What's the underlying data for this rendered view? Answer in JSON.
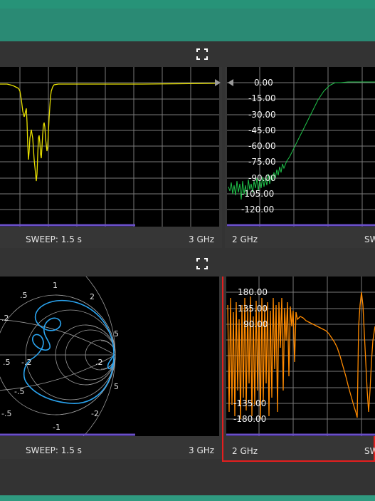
{
  "panels": {
    "top_left": {
      "sweep_label": "SWEEP: 1.5 s",
      "freq_end": "3 GHz"
    },
    "top_right": {
      "y_ticks": [
        "0.00",
        "-15.00",
        "-30.00",
        "-45.00",
        "-60.00",
        "-75.00",
        "-90.00",
        "-105.00",
        "-120.00"
      ],
      "freq_start": "2 GHz",
      "sweep_label": "SW"
    },
    "bottom_left": {
      "sweep_label": "SWEEP: 1.5 s",
      "freq_end": "3 GHz",
      "smith_labels": [
        "1",
        ".5",
        "2",
        ".2",
        ".5",
        "5",
        "-.2",
        "-.5",
        "-2",
        "-1",
        "-.5",
        "5",
        ".2"
      ]
    },
    "bottom_right": {
      "y_ticks": [
        "180.00",
        "135.00",
        "90.00",
        "-135.00",
        "-180.00"
      ],
      "freq_start": "2 GHz",
      "sweep_label": "SW"
    }
  },
  "colors": {
    "trace_yellow": "#e8e000",
    "trace_green": "#1fc24a",
    "trace_blue": "#2aa4f0",
    "trace_orange": "#ff8a00",
    "scan_bar": "#6a4fc8",
    "selection": "#e41e1e"
  }
}
